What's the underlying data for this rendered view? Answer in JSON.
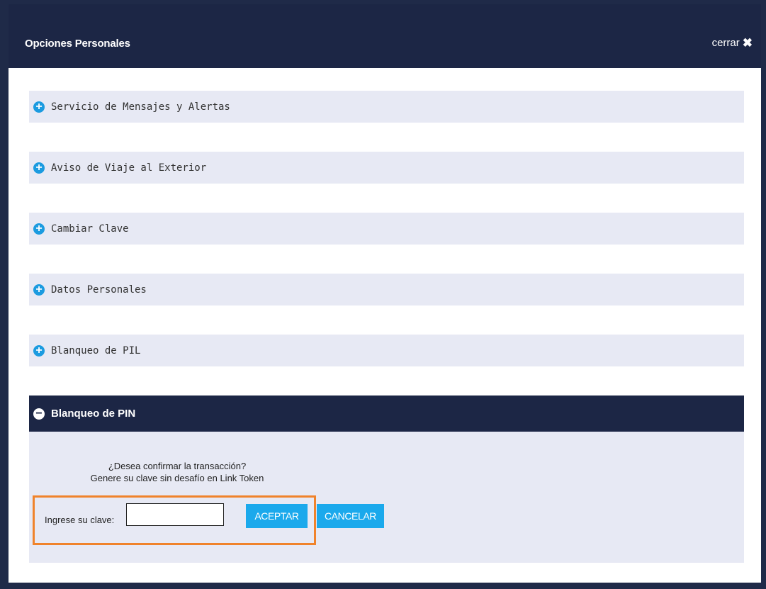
{
  "header": {
    "title": "Opciones Personales",
    "close_label": "cerrar",
    "close_icon": "✖"
  },
  "accordion": [
    {
      "label": "Servicio de Mensajes y Alertas",
      "icon": "plus-circle",
      "expanded": false
    },
    {
      "label": "Aviso de Viaje al Exterior",
      "icon": "plus-circle",
      "expanded": false
    },
    {
      "label": "Cambiar Clave",
      "icon": "plus-circle",
      "expanded": false
    },
    {
      "label": "Datos Personales",
      "icon": "plus-circle",
      "expanded": false
    },
    {
      "label": "Blanqueo de PIL",
      "icon": "plus-circle",
      "expanded": false
    },
    {
      "label": "Blanqueo de PIN",
      "icon": "minus-circle",
      "expanded": true
    }
  ],
  "pin_section": {
    "question": "¿Desea confirmar la transacción?",
    "hint": "Genere su clave sin desafío en Link Token",
    "input_label": "Ingrese su clave:",
    "input_value": "",
    "accept_label": "ACEPTAR",
    "cancel_label": "CANCELAR"
  },
  "colors": {
    "header_bg": "#1c2645",
    "accordion_bg": "#e7e9f4",
    "accent": "#1b9be0",
    "highlight": "#f0832b"
  }
}
